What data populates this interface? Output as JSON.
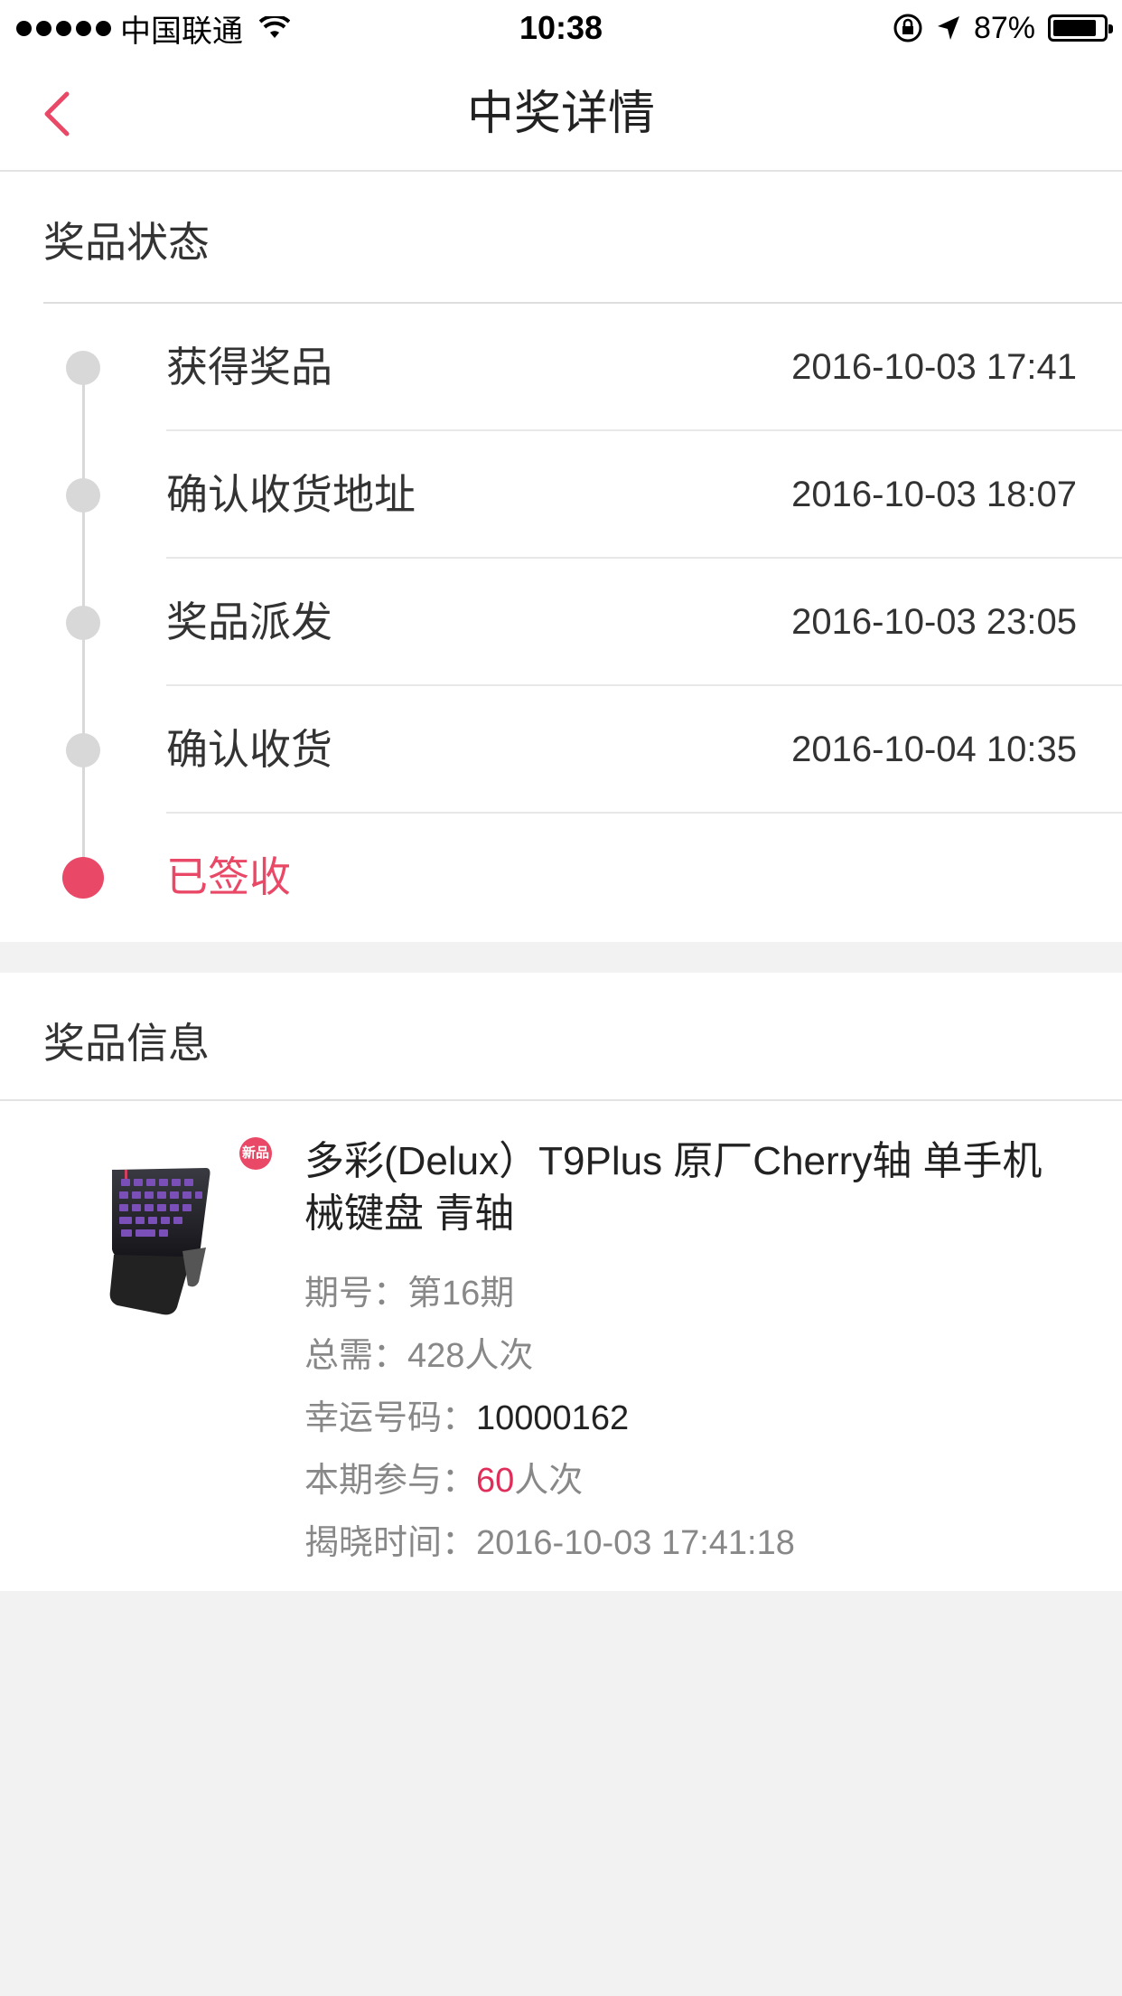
{
  "status_bar": {
    "carrier": "中国联通",
    "time": "10:38",
    "battery": "87%",
    "battery_level": 0.87
  },
  "nav": {
    "title": "中奖详情"
  },
  "prize_status": {
    "title": "奖品状态",
    "steps": [
      {
        "label": "获得奖品",
        "time": "2016-10-03 17:41"
      },
      {
        "label": "确认收货地址",
        "time": "2016-10-03 18:07"
      },
      {
        "label": "奖品派发",
        "time": "2016-10-03 23:05"
      },
      {
        "label": "确认收货",
        "time": "2016-10-04 10:35"
      },
      {
        "label": "已签收",
        "time": ""
      }
    ]
  },
  "prize_info": {
    "title": "奖品信息",
    "badge": "新品",
    "product_name": "多彩(Delux）T9Plus 原厂Cherry轴 单手机械键盘 青轴",
    "issue_label": "期号：",
    "issue_value": "第16期",
    "total_label": "总需：",
    "total_value": "428人次",
    "lucky_label": "幸运号码：",
    "lucky_value": "10000162",
    "participate_label": "本期参与：",
    "participate_count": "60",
    "participate_unit": "人次",
    "reveal_label": "揭晓时间：",
    "reveal_value": "2016-10-03 17:41:18"
  },
  "colors": {
    "accent": "#e94866",
    "timeline_inactive": "#d8d8d8",
    "background": "#f2f2f2"
  }
}
